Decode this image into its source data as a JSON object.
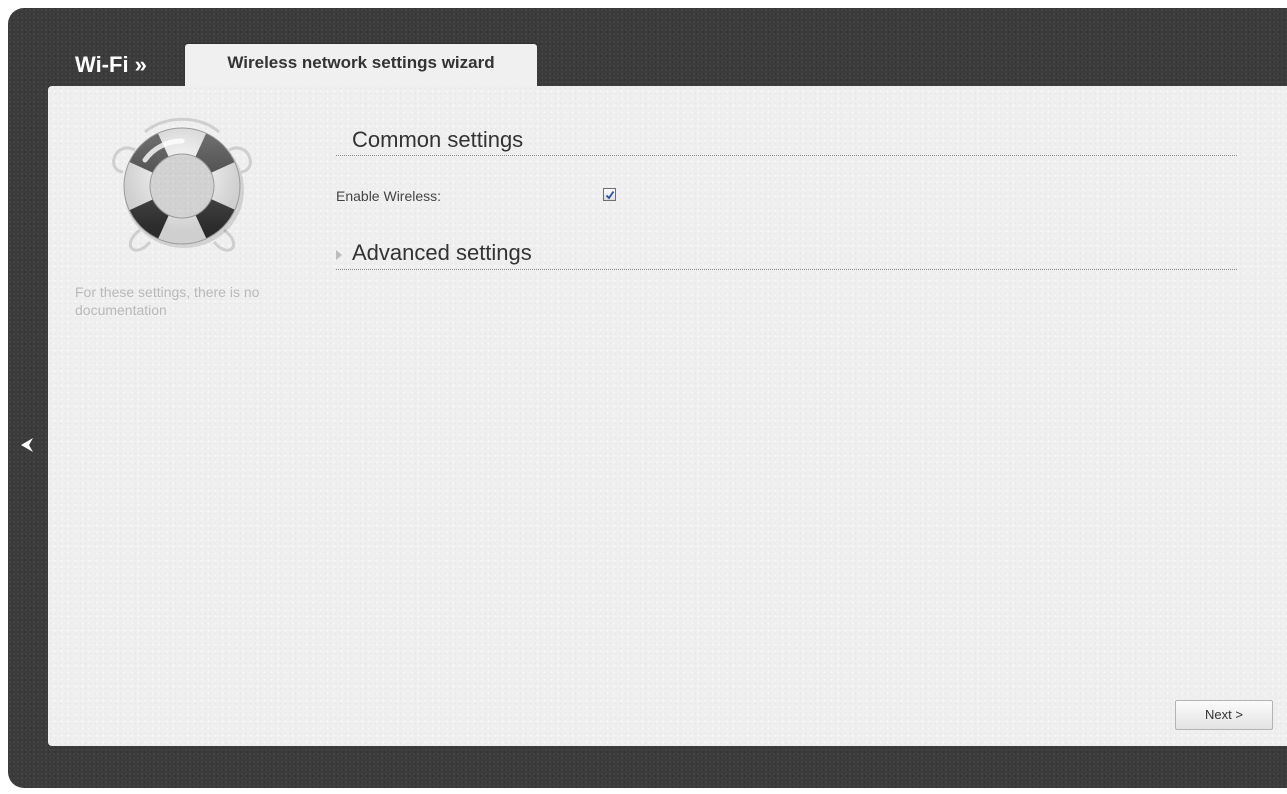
{
  "header": {
    "section_title": "Wi-Fi »",
    "active_tab": "Wireless network settings wizard"
  },
  "help": {
    "icon": "lifebuoy-icon",
    "text": "For these settings, there is no documentation"
  },
  "common_settings": {
    "title": "Common settings",
    "fields": [
      {
        "label": "Enable Wireless:",
        "type": "checkbox",
        "checked": true
      }
    ]
  },
  "advanced_settings": {
    "title": "Advanced settings",
    "expanded": false
  },
  "navigation": {
    "back_icon": "chevron-left-icon",
    "next_label": "Next >"
  },
  "colors": {
    "frame": "#3b3b3b",
    "panel": "#efefef",
    "help_text": "#b9b9b9",
    "checkmark": "#2b4fa0"
  }
}
